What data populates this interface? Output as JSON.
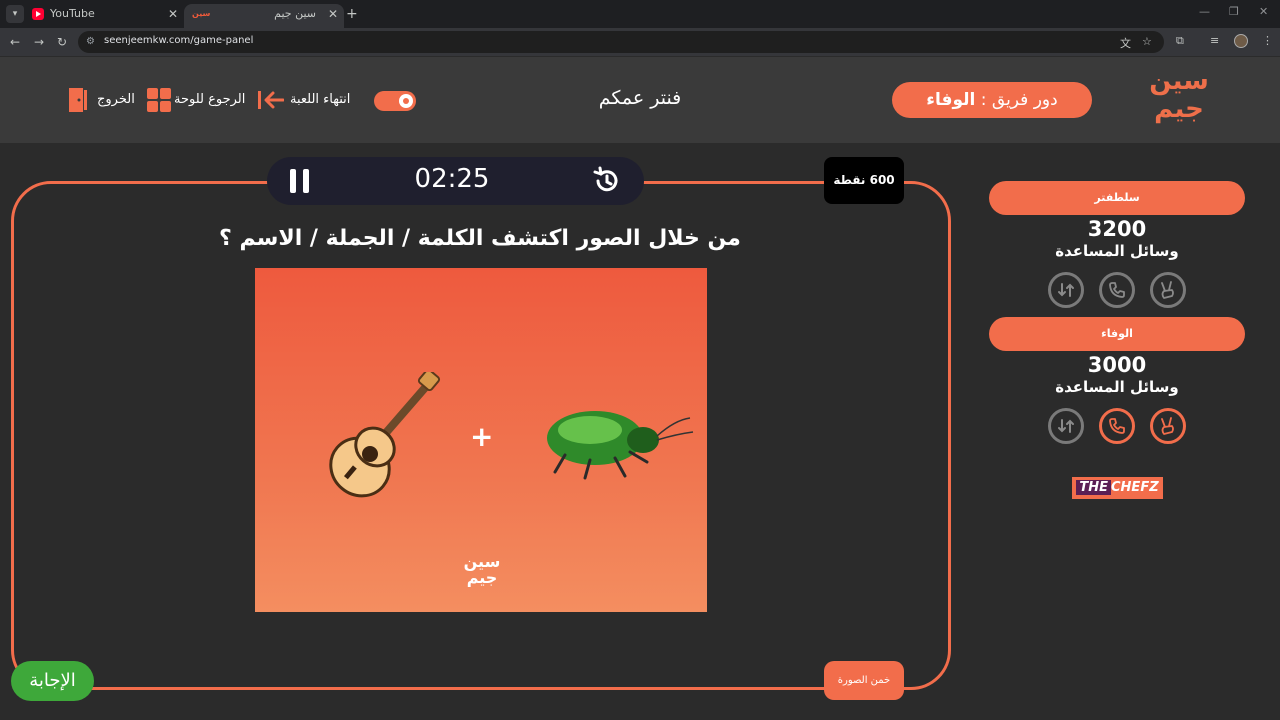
{
  "browser": {
    "tabs": [
      {
        "title": "YouTube"
      },
      {
        "title": "سين جيم"
      }
    ],
    "url": "seenjeemkw.com/game-panel"
  },
  "header": {
    "logo_line1": "سين",
    "logo_line2": "جيم",
    "turn_label": "دور فريق :",
    "turn_team": "الوفاء",
    "center_title": "فنتر عمكم",
    "end_game": "انتهاء اللعبة",
    "back_to_board": "الرجوع للوحة",
    "exit": "الخروج"
  },
  "game": {
    "timer": "02:25",
    "points": "600 نقطة",
    "question": "من خلال الصور اكتشف الكلمة / الجملة / الاسم ؟",
    "puzzle_plus": "+",
    "puzzle_logo1": "سين",
    "puzzle_logo2": "جيم",
    "guess_button": "خمن الصورة",
    "answer_button": "الإجابة"
  },
  "teams": [
    {
      "name": "سلطفتر",
      "score": "3200",
      "helpers_label": "وسائل المساعدة"
    },
    {
      "name": "الوفاء",
      "score": "3000",
      "helpers_label": "وسائل المساعدة"
    }
  ],
  "sponsor": {
    "part1": "THE",
    "part2": "CHEFZ"
  },
  "colors": {
    "accent": "#f26d4b",
    "answer": "#3ea83a",
    "background": "#2b2b2b",
    "header": "#3a3a3a"
  }
}
